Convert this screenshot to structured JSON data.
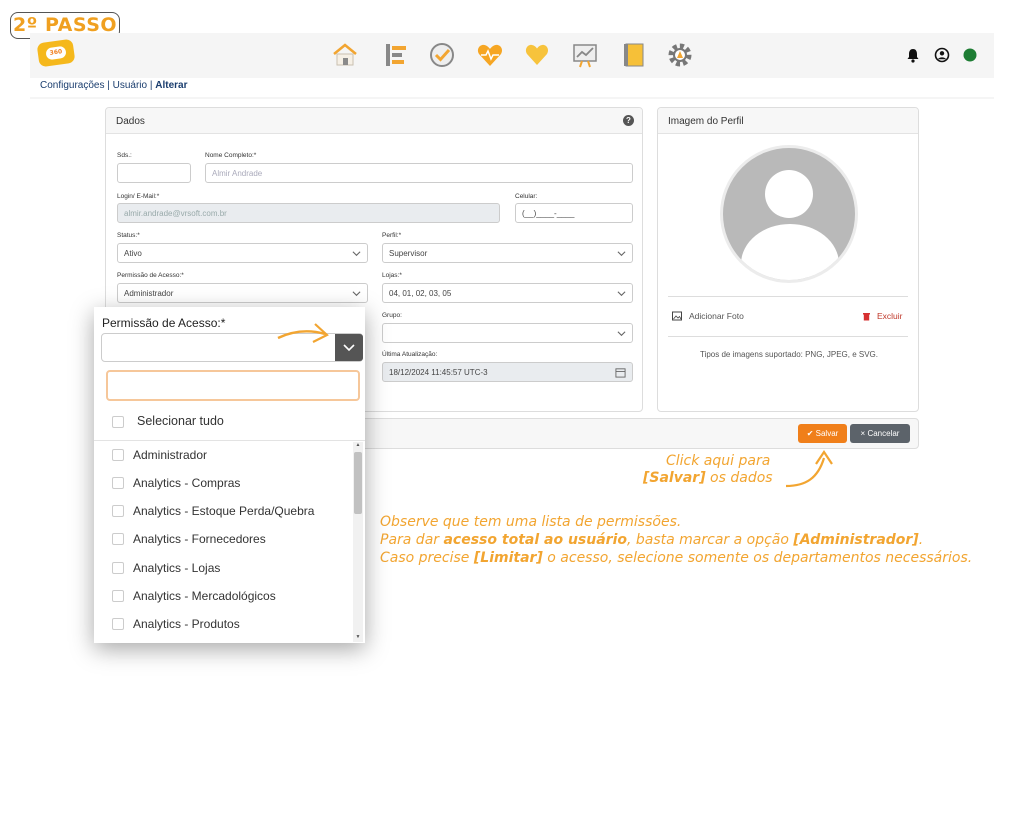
{
  "step": "2º PASSO",
  "breadcrumb": {
    "part1": "Configurações | Usuário | ",
    "current": "Alterar"
  },
  "colors": {
    "accent": "#f07f1a",
    "annotation": "#f2a531",
    "status_online": "#1e7d34"
  },
  "nav_icons": [
    "home-icon",
    "tasks-icon",
    "checklist-icon",
    "health-icon",
    "heart-icon",
    "chart-board-icon",
    "notebook-icon",
    "settings-gear-icon"
  ],
  "topbar_right_icons": [
    "bell-icon",
    "user-circle-icon",
    "status-dot-icon"
  ],
  "dados": {
    "title": "Dados",
    "sds_label": "Sds.:",
    "sds_value": "",
    "nome_label": "Nome Completo:*",
    "nome_value": "Almir Andrade",
    "login_label": "Login/ E-Mail:*",
    "login_value": "almir.andrade@vrsoft.com.br",
    "celular_label": "Celular:",
    "celular_value": "(__)____-____",
    "status_label": "Status:*",
    "status_value": "Ativo",
    "perfil_label": "Perfil:*",
    "perfil_value": "Supervisor",
    "permissao_label": "Permissão de Acesso:*",
    "permissao_value": "Administrador",
    "lojas_label": "Lojas:*",
    "lojas_value": "04, 01, 02, 03, 05",
    "grupo_label": "Grupo:",
    "grupo_value": "",
    "ultima_label": "Última Atualização:",
    "ultima_value": "18/12/2024 11:45:57 UTC-3"
  },
  "perfil": {
    "title": "Imagem do Perfil",
    "add_photo": "Adicionar Foto",
    "delete": "Excluir",
    "supported": "Tipos de imagens suportado: PNG, JPEG, e SVG."
  },
  "actions": {
    "save": "Salvar",
    "cancel": "Cancelar"
  },
  "dropdown": {
    "label": "Permissão de Acesso:*",
    "search_value": "",
    "select_all": "Selecionar tudo",
    "options": [
      "Administrador",
      "Analytics - Compras",
      "Analytics - Estoque Perda/Quebra",
      "Analytics - Fornecedores",
      "Analytics - Lojas",
      "Analytics - Mercadológicos",
      "Analytics - Produtos"
    ]
  },
  "annotations": {
    "click_line1": "Click aqui para",
    "click_save": "[Salvar]",
    "click_rest": " os dados",
    "obs_line1": "Observe que tem uma lista de permissões.",
    "obs_line2_a": "Para dar ",
    "obs_line2_b": "acesso total ao usuário",
    "obs_line2_c": ", basta marcar a opção ",
    "obs_line2_d": "[Administrador]",
    "obs_line2_e": ".",
    "obs_line3_a": "Caso precise ",
    "obs_line3_b": "[Limitar]",
    "obs_line3_c": " o acesso, selecione somente os departamentos necessários."
  }
}
